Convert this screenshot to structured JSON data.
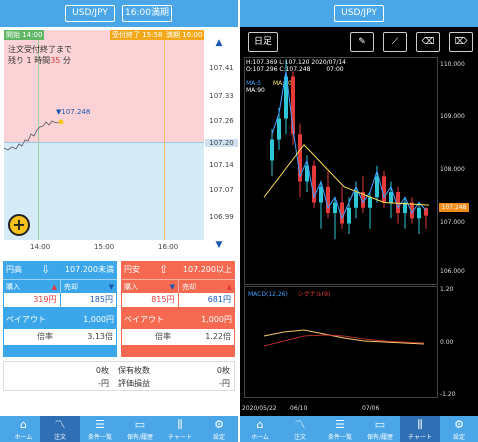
{
  "left": {
    "currency_pair": "USD/JPY",
    "expiry_button": "16:00満期",
    "start_tag": "開始 14:00",
    "accept_end_tag": "受付終了 15:58",
    "expiry_tag": "満期 16:00",
    "order_note_line1": "注文受付終了まで",
    "order_note_prefix": "残り",
    "order_note_hours": "1",
    "order_note_hours_unit": "時間",
    "order_note_minutes": "35",
    "order_note_minutes_unit": "分",
    "current_price": "107.248",
    "y_ticks": [
      "107.41",
      "107.33",
      "107.26",
      "107.20",
      "107.14",
      "107.07",
      "106.99"
    ],
    "x_ticks": [
      "14:00",
      "15:00",
      "16:00"
    ],
    "up_card": {
      "title": "円高",
      "strike": "107.200未満",
      "buy_label": "購入",
      "sell_label": "売却",
      "buy_price": "319円",
      "sell_price": "185円",
      "payout_label": "ペイアウト",
      "payout": "1,000円",
      "ratio_label": "倍率",
      "ratio": "3.13倍"
    },
    "down_card": {
      "title": "円安",
      "strike": "107.200以上",
      "buy_label": "購入",
      "sell_label": "売却",
      "buy_price": "815円",
      "sell_price": "681円",
      "payout_label": "ペイアウト",
      "payout": "1,000円",
      "ratio_label": "倍率",
      "ratio": "1.22倍"
    },
    "position": {
      "lots_a": "0枚",
      "yen_a": "-円",
      "holdings_label": "保有枚数",
      "holdings": "0枚",
      "pnl_label": "評価損益",
      "pnl": "-円"
    },
    "tabs": [
      {
        "label": "ホーム",
        "icon": "home-icon"
      },
      {
        "label": "注文",
        "icon": "chart-line-icon"
      },
      {
        "label": "条件一覧",
        "icon": "list-icon"
      },
      {
        "label": "保有/履歴",
        "icon": "inbox-icon"
      },
      {
        "label": "チャート",
        "icon": "candlestick-icon"
      },
      {
        "label": "設定",
        "icon": "gear-icon"
      }
    ]
  },
  "right": {
    "currency_pair": "USD/JPY",
    "timeframe": "日足",
    "ohlc": {
      "h": "H:107.369",
      "l": "L:107.120",
      "date": "2020/07/14",
      "o": "O:107.296",
      "c": "C:107.248",
      "time": "07:00"
    },
    "ma5": "MA:5",
    "ma20": "MA:20",
    "ma90": "MA:90",
    "y_ticks": [
      "110.000",
      "109.000",
      "108.000",
      "107.000",
      "106.000"
    ],
    "price_tag": "107.248",
    "macd_label": "MACD(12,26)",
    "signal_label": "シグナル(9)",
    "macd_ticks": [
      "1.20",
      "0.00",
      "-1.20"
    ],
    "x_ticks": [
      "2020/05/22",
      "06/10",
      "07/06"
    ],
    "tabs": [
      {
        "label": "ホーム",
        "icon": "home-icon"
      },
      {
        "label": "注文",
        "icon": "chart-line-icon"
      },
      {
        "label": "条件一覧",
        "icon": "list-icon"
      },
      {
        "label": "保有/履歴",
        "icon": "inbox-icon"
      },
      {
        "label": "チャート",
        "icon": "candlestick-icon"
      },
      {
        "label": "設定",
        "icon": "gear-icon"
      }
    ]
  },
  "colors": {
    "header": "#4aa6e6",
    "up_card": "#3ba6ea",
    "down_card": "#f4694f",
    "candle_up": "#2fc7d6",
    "candle_down": "#e43a3a",
    "ma5": "#3ea0ff",
    "ma20": "#ffe45a",
    "ma90": "#ffffff"
  }
}
